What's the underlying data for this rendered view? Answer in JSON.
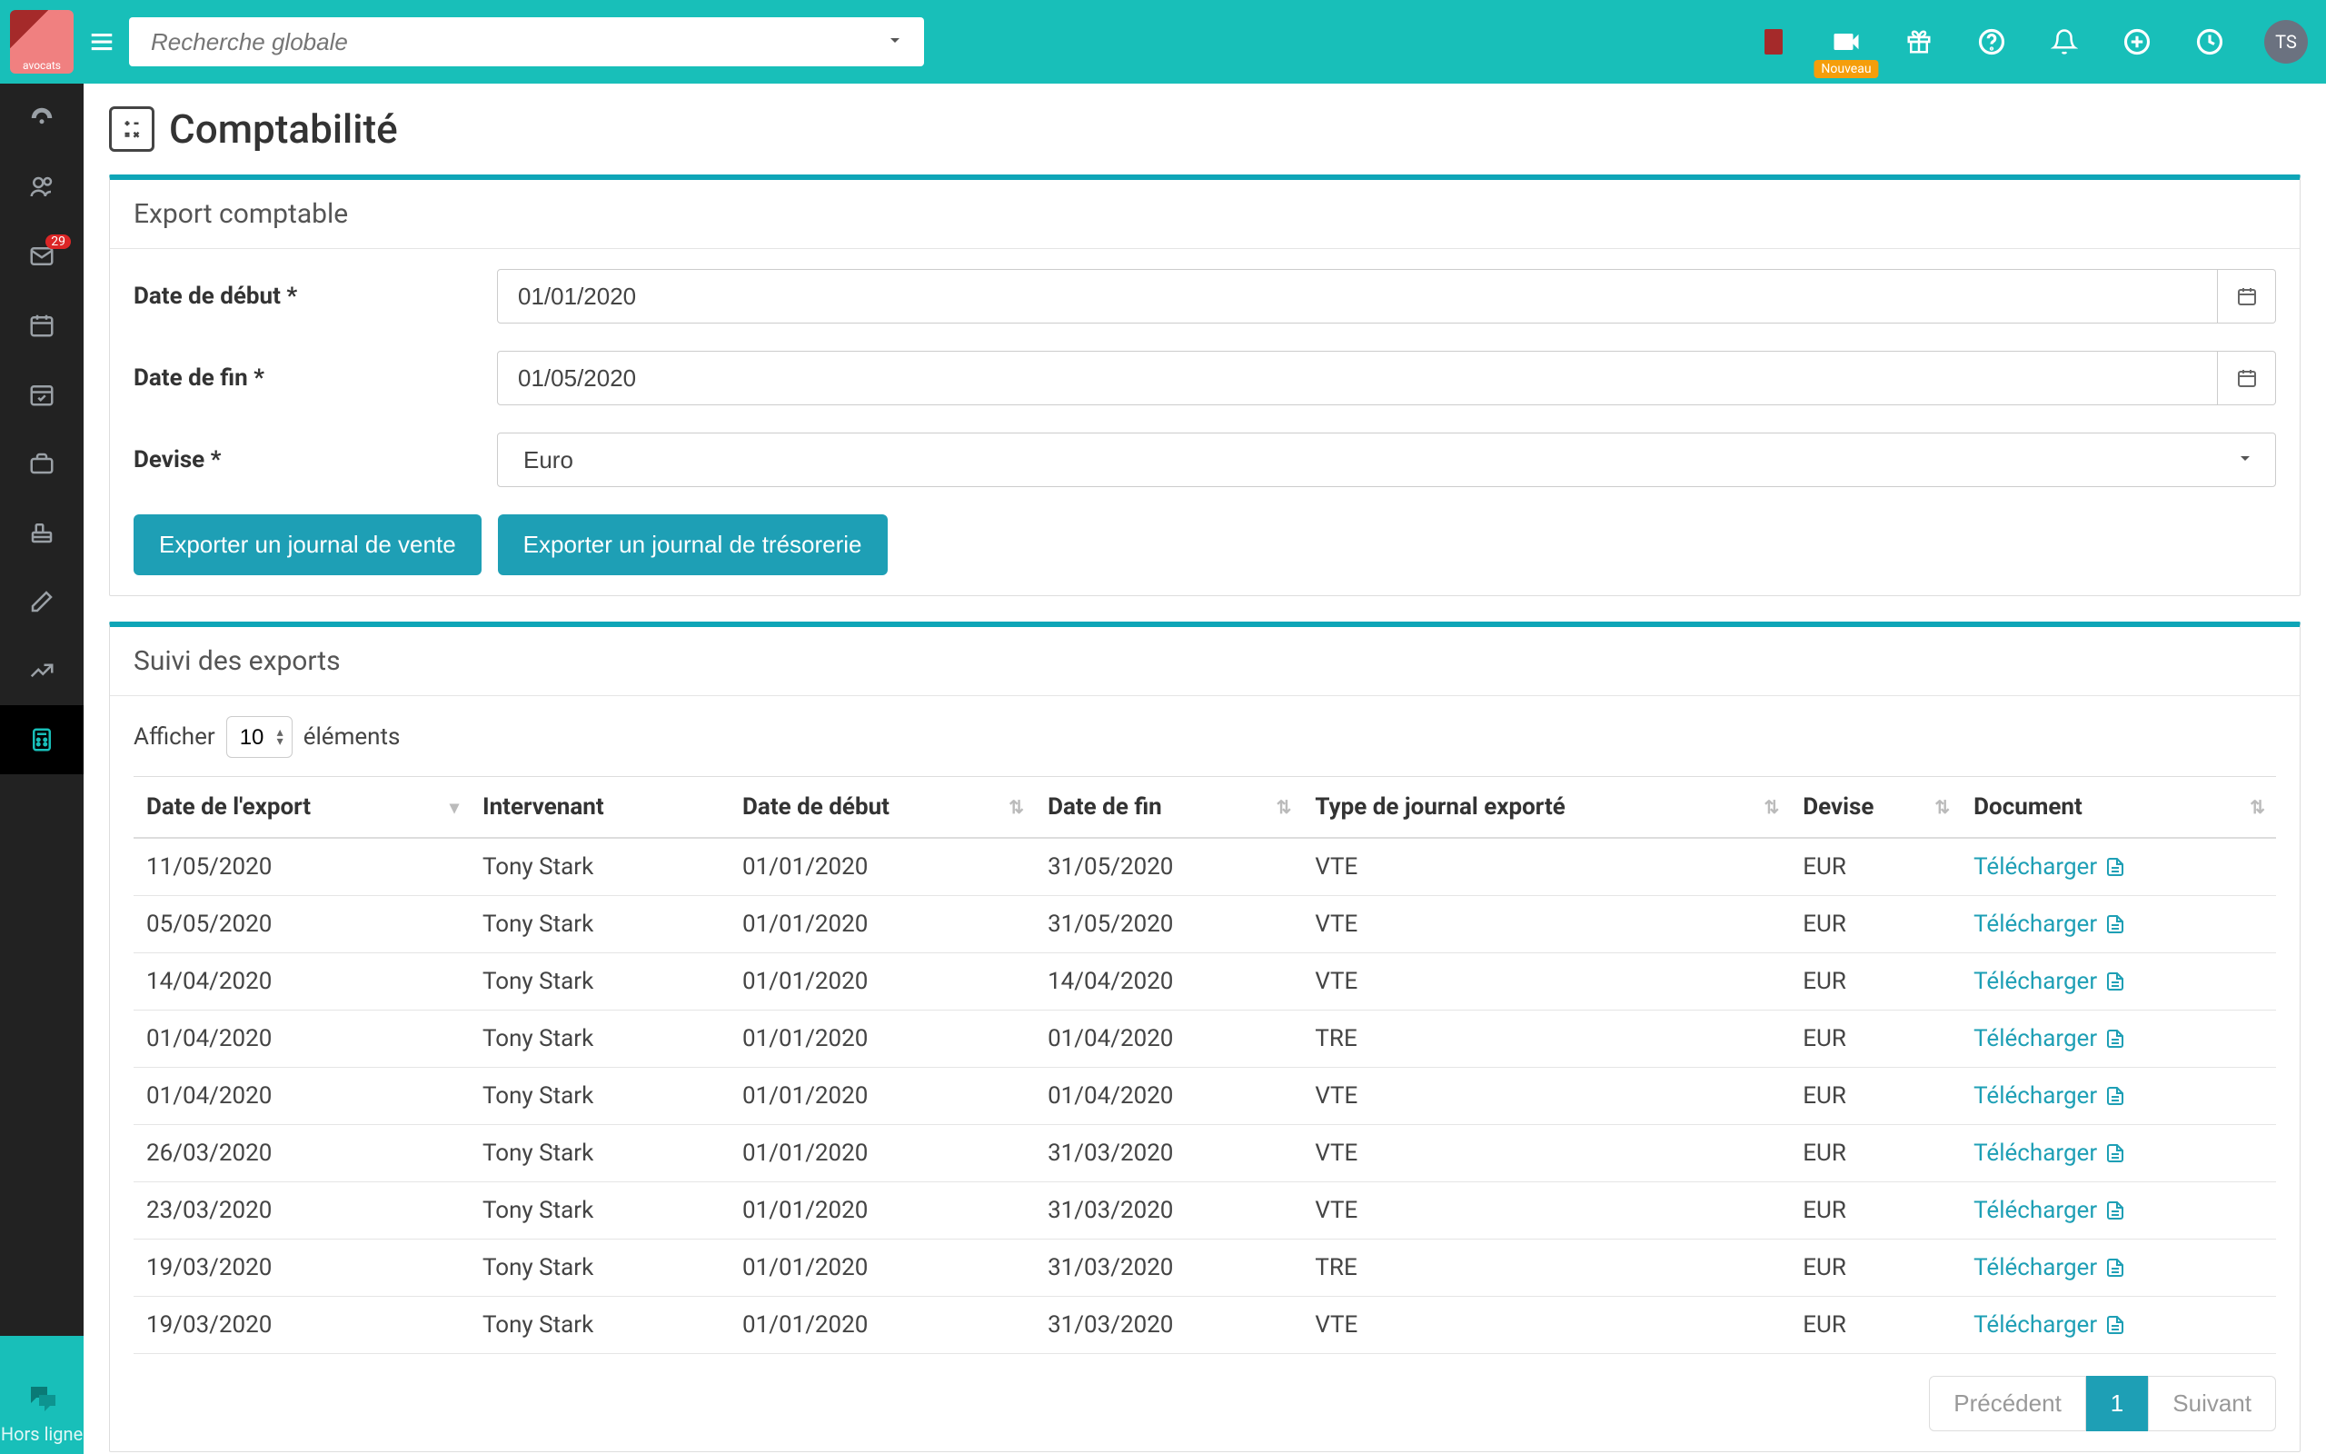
{
  "header": {
    "search_placeholder": "Recherche globale",
    "badge_new": "Nouveau",
    "avatar_initials": "TS",
    "logo_text": "avocats"
  },
  "sidebar": {
    "mail_badge": "29",
    "offline_label": "Hors ligne"
  },
  "page": {
    "title": "Comptabilité"
  },
  "export_panel": {
    "title": "Export comptable",
    "date_start_label": "Date de début *",
    "date_start_value": "01/01/2020",
    "date_end_label": "Date de fin *",
    "date_end_value": "01/05/2020",
    "currency_label": "Devise *",
    "currency_value": "Euro",
    "btn_sales": "Exporter un journal de vente",
    "btn_treasury": "Exporter un journal de trésorerie"
  },
  "followup_panel": {
    "title": "Suivi des exports",
    "show_prefix": "Afficher",
    "show_suffix": "éléments",
    "page_length": "10",
    "columns": {
      "export_date": "Date de l'export",
      "user": "Intervenant",
      "start": "Date de début",
      "end": "Date de fin",
      "type": "Type de journal exporté",
      "currency": "Devise",
      "document": "Document"
    },
    "download_label": "Télécharger",
    "rows": [
      {
        "export_date": "11/05/2020",
        "user": "Tony Stark",
        "start": "01/01/2020",
        "end": "31/05/2020",
        "type": "VTE",
        "currency": "EUR"
      },
      {
        "export_date": "05/05/2020",
        "user": "Tony Stark",
        "start": "01/01/2020",
        "end": "31/05/2020",
        "type": "VTE",
        "currency": "EUR"
      },
      {
        "export_date": "14/04/2020",
        "user": "Tony Stark",
        "start": "01/01/2020",
        "end": "14/04/2020",
        "type": "VTE",
        "currency": "EUR"
      },
      {
        "export_date": "01/04/2020",
        "user": "Tony Stark",
        "start": "01/01/2020",
        "end": "01/04/2020",
        "type": "TRE",
        "currency": "EUR"
      },
      {
        "export_date": "01/04/2020",
        "user": "Tony Stark",
        "start": "01/01/2020",
        "end": "01/04/2020",
        "type": "VTE",
        "currency": "EUR"
      },
      {
        "export_date": "26/03/2020",
        "user": "Tony Stark",
        "start": "01/01/2020",
        "end": "31/03/2020",
        "type": "VTE",
        "currency": "EUR"
      },
      {
        "export_date": "23/03/2020",
        "user": "Tony Stark",
        "start": "01/01/2020",
        "end": "31/03/2020",
        "type": "VTE",
        "currency": "EUR"
      },
      {
        "export_date": "19/03/2020",
        "user": "Tony Stark",
        "start": "01/01/2020",
        "end": "31/03/2020",
        "type": "TRE",
        "currency": "EUR"
      },
      {
        "export_date": "19/03/2020",
        "user": "Tony Stark",
        "start": "01/01/2020",
        "end": "31/03/2020",
        "type": "VTE",
        "currency": "EUR"
      }
    ],
    "pager_prev": "Précédent",
    "pager_page": "1",
    "pager_next": "Suivant"
  }
}
